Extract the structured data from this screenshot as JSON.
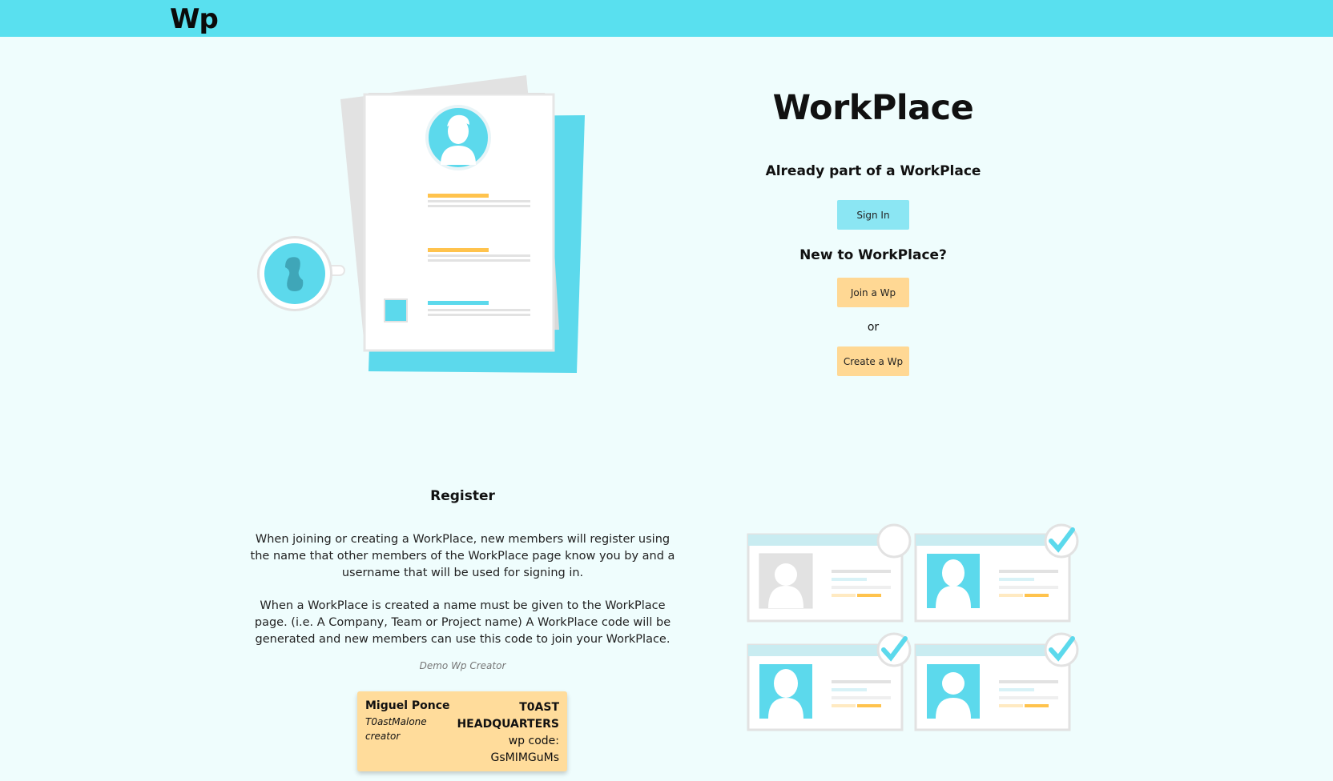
{
  "header": {
    "logo": "Wp"
  },
  "hero": {
    "title": "WorkPlace",
    "signin_prompt": "Already part of a WorkPlace",
    "signin_label": "Sign In",
    "new_prompt": "New to WorkPlace?",
    "join_label": "Join a Wp",
    "or_text": "or",
    "create_label": "Create a Wp"
  },
  "register": {
    "heading": "Register",
    "paragraph1": "When joining or creating a WorkPlace, new members will register using the name that other members of the WorkPlace page know you by and a username that will be used for signing in.",
    "paragraph2": "When a WorkPlace is created a name must be given to the WorkPlace page. (i.e. A Company, Team or Project name) A WorkPlace code will be generated and new members can use this code to join your WorkPlace.",
    "demo_label": "Demo Wp Creator",
    "demo_card": {
      "name": "Miguel Ponce",
      "username": "T0astMalone",
      "role": "creator",
      "org": "T0AST HEADQUARTERS",
      "code_label": "wp code:",
      "code": "GsMIMGuMs"
    }
  },
  "colors": {
    "header_bg": "#59e0ef",
    "page_bg": "#effdfd",
    "signin_btn": "#8be6f3",
    "action_btn": "#ffd894",
    "accent": "#5cd9ec",
    "highlight": "#ffc34d"
  },
  "icons": [
    "resume-illustration",
    "coffee-cup-icon",
    "profile-cards-illustration",
    "check-icon"
  ]
}
